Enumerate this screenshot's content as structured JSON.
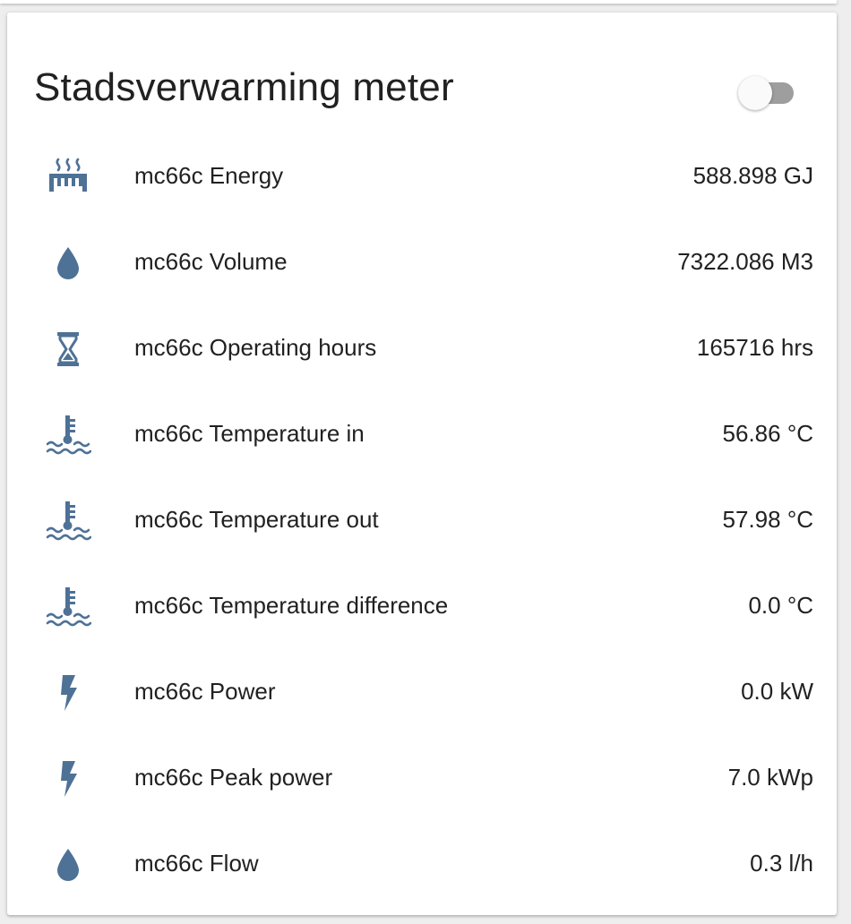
{
  "card": {
    "title": "Stadsverwarming meter",
    "toggle_on": false
  },
  "colors": {
    "icon": "#4e7196",
    "text": "#212121",
    "toggle_track": "#9e9e9e",
    "toggle_thumb": "#fafafa"
  },
  "entities": [
    {
      "icon": "radiator-icon",
      "label": "mc66c Energy",
      "value": "588.898 GJ"
    },
    {
      "icon": "water-drop-icon",
      "label": "mc66c Volume",
      "value": "7322.086 M3"
    },
    {
      "icon": "hourglass-icon",
      "label": "mc66c Operating hours",
      "value": "165716 hrs"
    },
    {
      "icon": "thermometer-water-icon",
      "label": "mc66c Temperature in",
      "value": "56.86 °C"
    },
    {
      "icon": "thermometer-water-icon",
      "label": "mc66c Temperature out",
      "value": "57.98 °C"
    },
    {
      "icon": "thermometer-water-icon",
      "label": "mc66c Temperature difference",
      "value": "0.0 °C"
    },
    {
      "icon": "flash-icon",
      "label": "mc66c Power",
      "value": "0.0 kW"
    },
    {
      "icon": "flash-icon",
      "label": "mc66c Peak power",
      "value": "7.0 kWp"
    },
    {
      "icon": "water-drop-icon",
      "label": "mc66c Flow",
      "value": "0.3 l/h"
    }
  ]
}
